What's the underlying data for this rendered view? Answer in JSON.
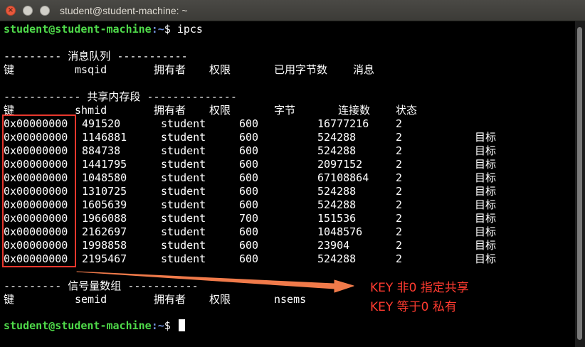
{
  "window": {
    "title": "student@student-machine: ~"
  },
  "prompt": {
    "user_host": "student@student-machine",
    "path": ":~",
    "symbol": "$ ",
    "command": "ipcs"
  },
  "queues": {
    "header": "--------- 消息队列 -----------",
    "columns": [
      "键",
      "msqid",
      "拥有者",
      "权限",
      "已用字节数",
      "消息"
    ]
  },
  "shm": {
    "header": "------------ 共享内存段 --------------",
    "columns": [
      "键",
      "shmid",
      "拥有者",
      "权限",
      "字节",
      "连接数",
      "状态"
    ],
    "rows": [
      {
        "key": "0x00000000",
        "shmid": "491520",
        "owner": "student",
        "perms": "600",
        "bytes": "16777216",
        "nattch": "2",
        "status": ""
      },
      {
        "key": "0x00000000",
        "shmid": "1146881",
        "owner": "student",
        "perms": "600",
        "bytes": "524288",
        "nattch": "2",
        "status": "目标"
      },
      {
        "key": "0x00000000",
        "shmid": "884738",
        "owner": "student",
        "perms": "600",
        "bytes": "524288",
        "nattch": "2",
        "status": "目标"
      },
      {
        "key": "0x00000000",
        "shmid": "1441795",
        "owner": "student",
        "perms": "600",
        "bytes": "2097152",
        "nattch": "2",
        "status": "目标"
      },
      {
        "key": "0x00000000",
        "shmid": "1048580",
        "owner": "student",
        "perms": "600",
        "bytes": "67108864",
        "nattch": "2",
        "status": "目标"
      },
      {
        "key": "0x00000000",
        "shmid": "1310725",
        "owner": "student",
        "perms": "600",
        "bytes": "524288",
        "nattch": "2",
        "status": "目标"
      },
      {
        "key": "0x00000000",
        "shmid": "1605639",
        "owner": "student",
        "perms": "600",
        "bytes": "524288",
        "nattch": "2",
        "status": "目标"
      },
      {
        "key": "0x00000000",
        "shmid": "1966088",
        "owner": "student",
        "perms": "700",
        "bytes": "151536",
        "nattch": "2",
        "status": "目标"
      },
      {
        "key": "0x00000000",
        "shmid": "2162697",
        "owner": "student",
        "perms": "600",
        "bytes": "1048576",
        "nattch": "2",
        "status": "目标"
      },
      {
        "key": "0x00000000",
        "shmid": "1998858",
        "owner": "student",
        "perms": "600",
        "bytes": "23904",
        "nattch": "2",
        "status": "目标"
      },
      {
        "key": "0x00000000",
        "shmid": "2195467",
        "owner": "student",
        "perms": "600",
        "bytes": "524288",
        "nattch": "2",
        "status": "目标"
      }
    ]
  },
  "sem": {
    "header": "--------- 信号量数组 -----------",
    "columns": [
      "键",
      "semid",
      "拥有者",
      "权限",
      "nsems"
    ]
  },
  "annotation": {
    "line1": "KEY 非0 指定共享",
    "line2": "KEY 等于0 私有",
    "color": "#ff3b30"
  },
  "colors": {
    "prompt_user": "#4fda4a",
    "prompt_path": "#6f8fd6",
    "highlight_box": "#e8372d",
    "arrow": "#f07a4a"
  }
}
